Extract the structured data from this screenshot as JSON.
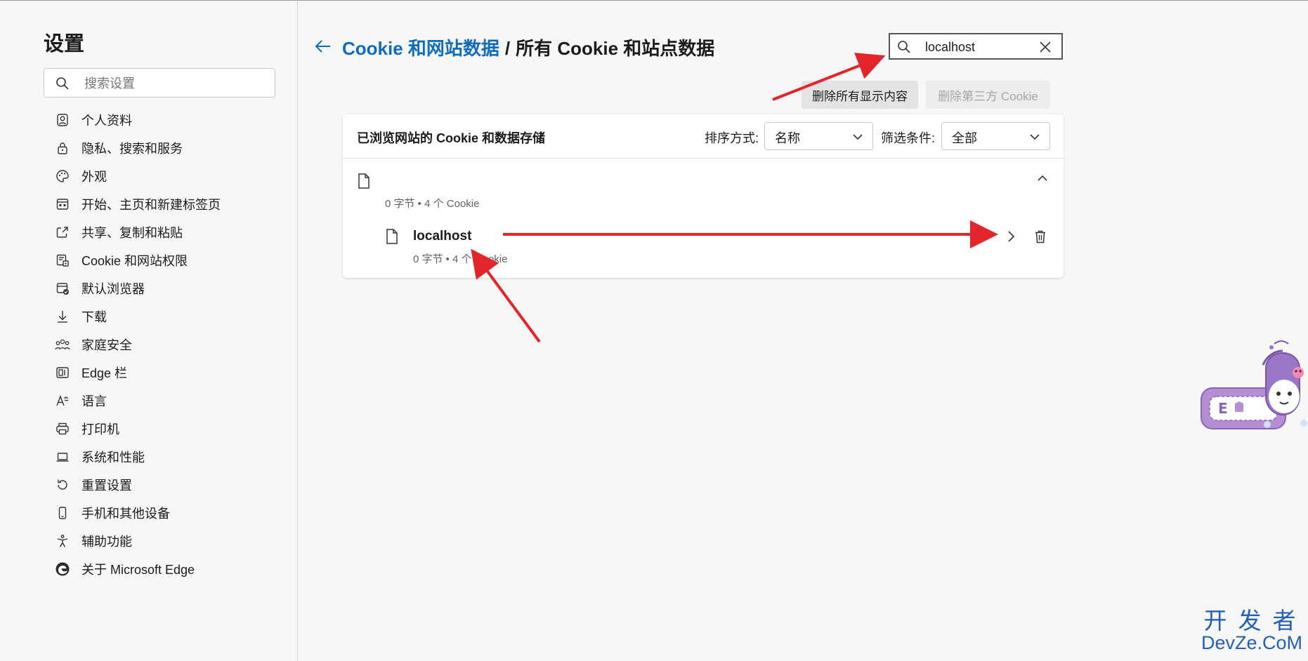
{
  "colors": {
    "accent": "#0f6cbd",
    "annotation_arrow": "#e3242b",
    "watermark": "#2360b5"
  },
  "sidebar": {
    "title": "设置",
    "search_placeholder": "搜索设置",
    "items": [
      {
        "label": "个人资料",
        "icon": "profile-icon"
      },
      {
        "label": "隐私、搜索和服务",
        "icon": "lock-icon"
      },
      {
        "label": "外观",
        "icon": "palette-icon"
      },
      {
        "label": "开始、主页和新建标签页",
        "icon": "start-page-icon"
      },
      {
        "label": "共享、复制和粘贴",
        "icon": "share-icon"
      },
      {
        "label": "Cookie 和网站权限",
        "icon": "site-permissions-icon"
      },
      {
        "label": "默认浏览器",
        "icon": "default-browser-icon"
      },
      {
        "label": "下载",
        "icon": "download-icon"
      },
      {
        "label": "家庭安全",
        "icon": "family-icon"
      },
      {
        "label": "Edge 栏",
        "icon": "edge-bar-icon"
      },
      {
        "label": "语言",
        "icon": "language-icon"
      },
      {
        "label": "打印机",
        "icon": "printer-icon"
      },
      {
        "label": "系统和性能",
        "icon": "laptop-icon"
      },
      {
        "label": "重置设置",
        "icon": "reset-icon"
      },
      {
        "label": "手机和其他设备",
        "icon": "phone-icon"
      },
      {
        "label": "辅助功能",
        "icon": "accessibility-icon"
      },
      {
        "label": "关于 Microsoft Edge",
        "icon": "edge-logo-icon"
      }
    ]
  },
  "header": {
    "breadcrumb_link": "Cookie 和网站数据",
    "breadcrumb_separator": "/",
    "breadcrumb_current": "所有 Cookie 和站点数据"
  },
  "cookie_search": {
    "value": "localhost"
  },
  "actions": {
    "delete_all_label": "删除所有显示内容",
    "delete_third_party_label": "删除第三方 Cookie"
  },
  "list": {
    "title": "已浏览网站的 Cookie 和数据存储",
    "sort_label": "排序方式:",
    "sort_value": "名称",
    "filter_label": "筛选条件:",
    "filter_value": "全部",
    "group": {
      "meta": "0 字节 • 4 个 Cookie"
    },
    "sites": [
      {
        "name": "localhost",
        "meta": "0 字节 • 4 个 Cookie"
      }
    ]
  },
  "watermark": {
    "line1": "开发者",
    "line2": "DevZe.CoM"
  }
}
